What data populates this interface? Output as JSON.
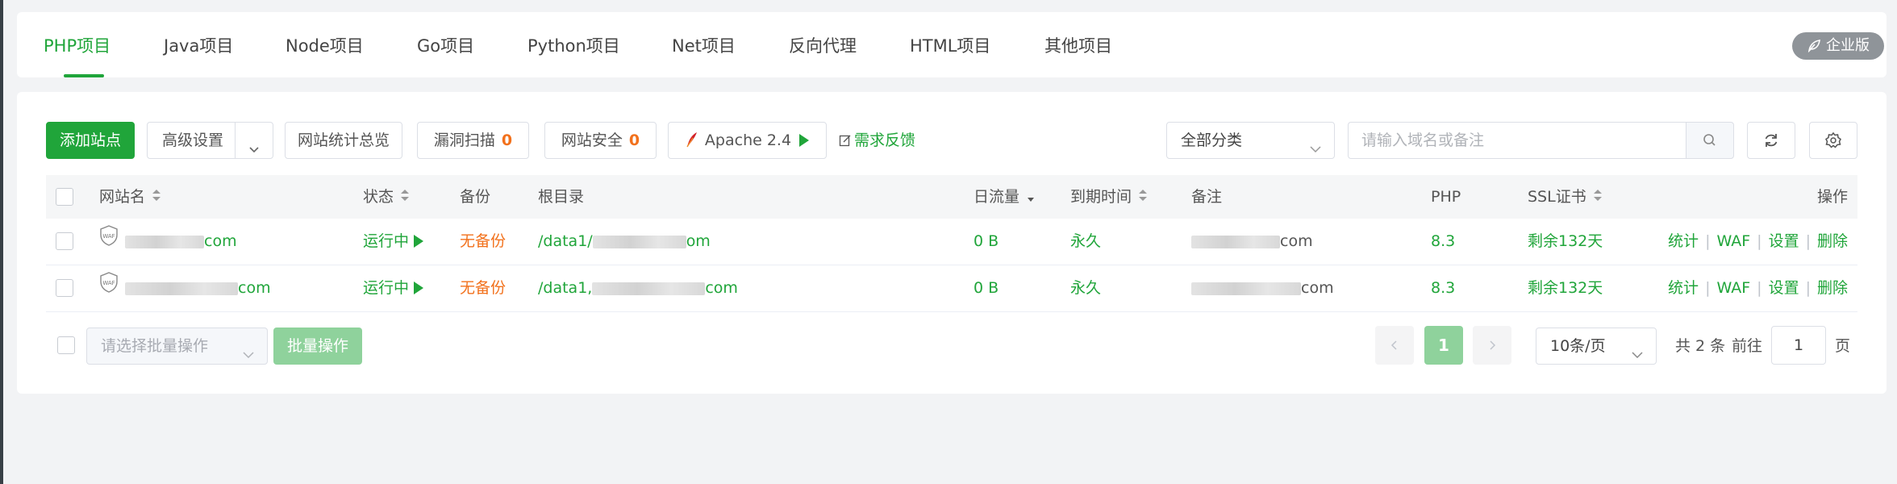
{
  "tabs": [
    {
      "label": "PHP项目",
      "active": true
    },
    {
      "label": "Java项目"
    },
    {
      "label": "Node项目"
    },
    {
      "label": "Go项目"
    },
    {
      "label": "Python项目"
    },
    {
      "label": "Net项目"
    },
    {
      "label": "反向代理"
    },
    {
      "label": "HTML项目"
    },
    {
      "label": "其他项目"
    }
  ],
  "enterprise_badge": "企业版",
  "toolbar": {
    "add_site": "添加站点",
    "advanced": "高级设置",
    "stats_overview": "网站统计总览",
    "vuln_scan": "漏洞扫描",
    "vuln_count": "0",
    "site_security": "网站安全",
    "security_count": "0",
    "apache": "Apache 2.4",
    "feedback": "需求反馈",
    "category": "全部分类",
    "search_placeholder": "请输入域名或备注"
  },
  "table": {
    "headers": {
      "name": "网站名",
      "status": "状态",
      "backup": "备份",
      "root": "根目录",
      "traffic": "日流量",
      "expire": "到期时间",
      "remark": "备注",
      "php": "PHP",
      "ssl": "SSL证书",
      "actions": "操作"
    },
    "rows": [
      {
        "name_suffix": "com",
        "status": "运行中",
        "backup": "无备份",
        "root_prefix": "/data1/",
        "root_suffix": "om",
        "traffic": "0 B",
        "expire": "永久",
        "remark_suffix": "com",
        "php": "8.3",
        "ssl": "剩余132天"
      },
      {
        "name_suffix": "com",
        "status": "运行中",
        "backup": "无备份",
        "root_prefix": "/data1,",
        "root_suffix": "com",
        "traffic": "0 B",
        "expire": "永久",
        "remark_suffix": "com",
        "php": "8.3",
        "ssl": "剩余132天"
      }
    ],
    "row_actions": [
      "统计",
      "WAF",
      "设置",
      "删除"
    ]
  },
  "footer": {
    "batch_placeholder": "请选择批量操作",
    "batch_button": "批量操作",
    "current_page": "1",
    "page_size": "10条/页",
    "total": "共 2 条",
    "goto_label": "前往",
    "goto_value": "1",
    "page_unit": "页"
  },
  "colors": {
    "accent": "#20a53a",
    "warning": "#f2711c"
  }
}
